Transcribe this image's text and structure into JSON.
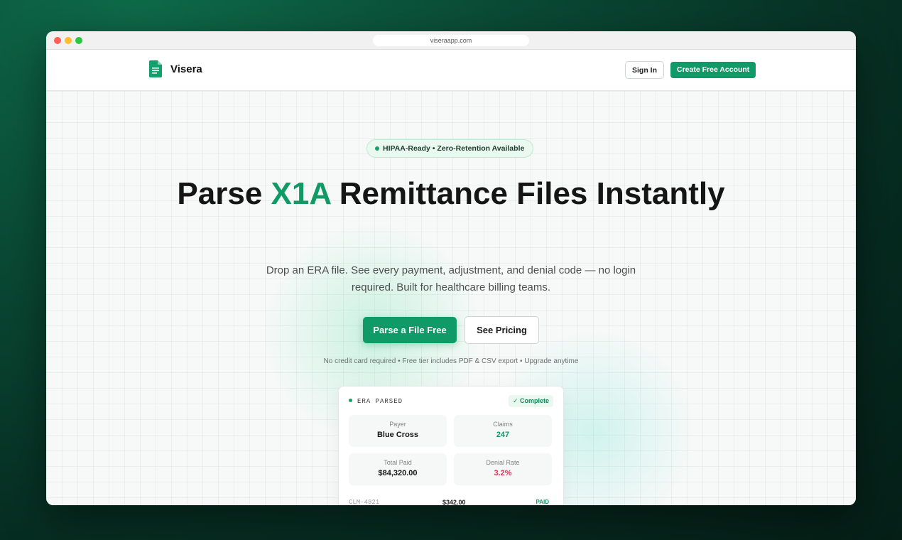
{
  "browser": {
    "url": "viseraapp.com"
  },
  "nav": {
    "brand": "Visera",
    "signin_label": "Sign In",
    "create_label": "Create Free Account"
  },
  "hero": {
    "badge": "HIPAA-Ready • Zero-Retention Available",
    "headline_pre": "Parse ",
    "headline_accent": "X1A",
    "headline_post": " Remittance Files Instantly",
    "subtext": "Drop an ERA file. See every payment, adjustment, and denial code — no login required. Built for healthcare billing teams.",
    "primary_cta": "Parse a File Free",
    "secondary_cta": "See Pricing",
    "fineprint": "No credit card required • Free tier includes PDF & CSV export • Upgrade anytime"
  },
  "card": {
    "title": "ERA PARSED",
    "status": "✓ Complete",
    "stats": [
      {
        "label": "Payer",
        "value": "Blue Cross"
      },
      {
        "label": "Claims",
        "value": "247"
      },
      {
        "label": "Total Paid",
        "value": "$84,320.00"
      },
      {
        "label": "Denial Rate",
        "value": "3.2%"
      }
    ],
    "rows": [
      {
        "claim_id": "CLM-4821",
        "amount": "$342.00",
        "status": "PAID"
      }
    ]
  },
  "colors": {
    "accent": "#0f9a68",
    "danger": "#e0305a",
    "background": "#062a1f"
  }
}
